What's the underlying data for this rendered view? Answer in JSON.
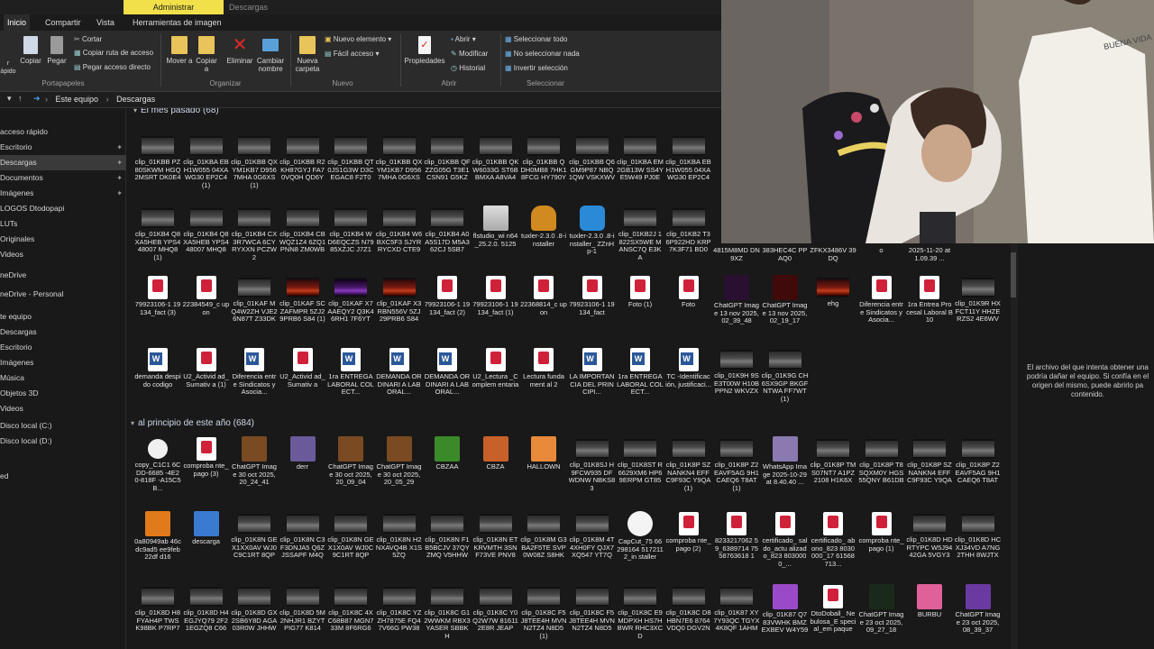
{
  "ribbon": {
    "context_tabs": {
      "admin": "Administrar",
      "downloads": "Descargas"
    },
    "tabs": [
      "Inicio",
      "Compartir",
      "Vista",
      "Herramientas de imagen"
    ],
    "clipboard": {
      "pin": "r\nápido",
      "copy": "Copiar",
      "paste": "Pegar",
      "cut": "Cortar",
      "copy_path": "Copiar ruta de acceso",
      "paste_shortcut": "Pegar acceso directo",
      "group": "Portapapeles"
    },
    "organize": {
      "move": "Mover a",
      "copy_to": "Copiar a",
      "delete": "Eliminar",
      "rename": "Cambiar nombre",
      "group": "Organizar"
    },
    "new": {
      "new_folder": "Nueva carpeta",
      "new_item": "Nuevo elemento",
      "easy_access": "Fácil acceso",
      "group": "Nuevo"
    },
    "open": {
      "properties": "Propiedades",
      "open": "Abrir",
      "edit": "Modificar",
      "history": "Historial",
      "group": "Abrir"
    },
    "select": {
      "select_all": "Seleccionar todo",
      "select_none": "No seleccionar nada",
      "invert": "Invertir selección",
      "group": "Seleccionar"
    }
  },
  "address": {
    "crumbs": [
      "Este equipo",
      "Descargas"
    ]
  },
  "sidebar": [
    {
      "label": "acceso rápido",
      "pin": false
    },
    {
      "label": "Escritorio",
      "pin": true
    },
    {
      "label": "Descargas",
      "pin": true,
      "selected": true
    },
    {
      "label": "Documentos",
      "pin": true
    },
    {
      "label": "Imágenes",
      "pin": true
    },
    {
      "label": "LOGOS Dtodopapi",
      "pin": false
    },
    {
      "label": "LUTs",
      "pin": false
    },
    {
      "label": "Originales",
      "pin": false
    },
    {
      "label": "Videos",
      "pin": false
    },
    {
      "label": "neDrive",
      "pin": false
    },
    {
      "label": "neDrive - Personal",
      "pin": false
    },
    {
      "label": "te equipo",
      "pin": false
    },
    {
      "label": "Descargas",
      "pin": false
    },
    {
      "label": "Escritorio",
      "pin": false
    },
    {
      "label": "Imágenes",
      "pin": false
    },
    {
      "label": "Música",
      "pin": false
    },
    {
      "label": "Objetos 3D",
      "pin": false
    },
    {
      "label": "Videos",
      "pin": false
    },
    {
      "label": "Disco local (C:)",
      "pin": false
    },
    {
      "label": "Disco local (D:)",
      "pin": false
    },
    {
      "label": "ed",
      "pin": false
    }
  ],
  "groups": {
    "last_month": "El mes pasado (68)",
    "this_year": "al principio de este año (684)"
  },
  "files_row1": [
    {
      "name": "clip_01KBB PZ80SKWM HGQ2MSRT DK0E4",
      "kind": "vid"
    },
    {
      "name": "clip_01KBA EBH1W055 04XAWG30 EP2C4 (1)",
      "kind": "vid"
    },
    {
      "name": "clip_01KBB QXYM1KB7 D9567MHA 0G6XS (1)",
      "kind": "vid"
    },
    {
      "name": "clip_01KBB R2KH87GYJ FA70VQ0H QD6Y",
      "kind": "vid"
    },
    {
      "name": "clip_01KBB QT0JS1G3W D3CEGAC8 F2T0",
      "kind": "vid"
    },
    {
      "name": "clip_01KBB QXYM1KB7 D9567MHA 0G6XS",
      "kind": "vid"
    },
    {
      "name": "clip_01KBB QFZZG05G T3E1CSN91 G5KZ",
      "kind": "vid"
    },
    {
      "name": "clip_01KBB QKW6033G ST6BBMXA A8VA4",
      "kind": "vid"
    },
    {
      "name": "clip_01KBB QDH0MB8 7HK18FCG HY790Y",
      "kind": "vid"
    },
    {
      "name": "clip_01KBB Q6GM9P87 NBQ1QW VSKXWV",
      "kind": "vid"
    },
    {
      "name": "clip_01KBA EM2GB13W SS4YE5W49 PJ0E",
      "kind": "vid"
    },
    {
      "name": "clip_01KBA EBH1W055 04XAWG30 EP2C4",
      "kind": "vid"
    }
  ],
  "files_row2": [
    {
      "name": "clip_01KB4 Q8XA5HEB YPS448007 MHQ8 (1)",
      "kind": "vid"
    },
    {
      "name": "clip_01KB4 Q8XA5HEB YPS448007 MHQ8",
      "kind": "vid"
    },
    {
      "name": "clip_01KB4 CX3R7WCA 6CYRYXXN PCZW2",
      "kind": "vid"
    },
    {
      "name": "clip_01KB4 CBWQZ1Z4 6ZQ1PNN8 ZM0WB",
      "kind": "vid"
    },
    {
      "name": "clip_01KB4 WD6EQCZS N7985XZJC J7Z1",
      "kind": "vid"
    },
    {
      "name": "clip_01KB4 W6BXC5F3 SJYRRYCXD CTE9",
      "kind": "vid"
    },
    {
      "name": "clip_01KB4 A0A5S17D M5A362CJ 5SB7",
      "kind": "vid"
    },
    {
      "name": "flstudio_wi n64_25.2.0. 5125",
      "kind": "app"
    },
    {
      "name": "tuxler-2.3.0 .8-installer",
      "kind": "app2"
    },
    {
      "name": "tuxler-2.3.0 .8-installer_ ZZnHp-1",
      "kind": "app3"
    },
    {
      "name": "clip_01KB2J 1822SX5WE MANSC7Q E3KA",
      "kind": "vid"
    },
    {
      "name": "clip_01KB2 T36P922HD KRP7K3F71 BD0",
      "kind": "vid"
    }
  ],
  "files_row3": [
    {
      "name": "79923106-1 19134_fact (3)",
      "kind": "pdf"
    },
    {
      "name": "22384549_c upon",
      "kind": "pdf"
    },
    {
      "name": "clip_01KAF MQ4W2ZH VJE26N87T Z33DK",
      "kind": "vid"
    },
    {
      "name": "clip_01KAF SCZAFMPR 5ZJ29PRB6 S84 (1)",
      "kind": "vid3"
    },
    {
      "name": "clip_01KAF X7AAEQY2 Q3K46RH1 7F6YT",
      "kind": "vid4"
    },
    {
      "name": "clip_01KAF X3RBN556V 5ZJ29PRB6 S84",
      "kind": "vid3"
    },
    {
      "name": "79923106-1 19134_fact (2)",
      "kind": "pdf"
    },
    {
      "name": "79923106-1 19134_fact (1)",
      "kind": "pdf"
    },
    {
      "name": "22368814_c upon",
      "kind": "pdf"
    },
    {
      "name": "79923106-1 19134_fact",
      "kind": "pdf"
    },
    {
      "name": "Foto (1)",
      "kind": "pdf"
    },
    {
      "name": "Foto",
      "kind": "pdf"
    },
    {
      "name": "ChatGPT Image 13 nov 2025, 02_39_48",
      "kind": "img-dark"
    },
    {
      "name": "ChatGPT Image 13 nov 2025, 02_19_17",
      "kind": "img-red"
    },
    {
      "name": "ehg",
      "kind": "vid3"
    },
    {
      "name": "Diferencia entre Sindicatos y Asocia...",
      "kind": "pdf"
    },
    {
      "name": "1ra Entrea Procesal Laboral B10",
      "kind": "pdf"
    },
    {
      "name": "clip_01K9R HXFCT11Y HHZERZS2 4E6WV",
      "kind": "vid"
    }
  ],
  "files_row3_top": [
    "4815M8MD DN9XZ",
    "383HEC4C PPAQ0",
    "ZFKX3486V 39DQ",
    "o",
    "2025-11-20 at 1.09.39 ..."
  ],
  "files_row4": [
    {
      "name": "demanda despido codigo",
      "kind": "doc"
    },
    {
      "name": "U2_Activid ad_Sumativ a (1)",
      "kind": "pdf"
    },
    {
      "name": "Diferencia entre Sindicatos y Asocia...",
      "kind": "doc"
    },
    {
      "name": "U2_Activid ad_Sumativ a",
      "kind": "pdf"
    },
    {
      "name": "1ra ENTREGA LABORAL COLECT...",
      "kind": "doc"
    },
    {
      "name": "DEMANDA ORDINARI A LABORAL...",
      "kind": "doc"
    },
    {
      "name": "DEMANDA ORDINARI A LABORAL...",
      "kind": "doc"
    },
    {
      "name": "U2_Lectura _Complem entaria",
      "kind": "pdf"
    },
    {
      "name": "Lectura fundament al 2",
      "kind": "pdf"
    },
    {
      "name": "LA IMPORTAN CIA DEL PRINCIPI...",
      "kind": "doc"
    },
    {
      "name": "1ra ENTREGA LABORAL COLECT...",
      "kind": "doc"
    },
    {
      "name": "TC -Identificac ión, justificaci...",
      "kind": "doc"
    },
    {
      "name": "clip_01K9H 9SE3T00W H10BPPN2 WKVZX",
      "kind": "vid"
    },
    {
      "name": "clip_01K9G CH6SX9GP BKGFNTWA FF7WT (1)",
      "kind": "vid"
    }
  ],
  "files_row5": [
    {
      "name": "copy_C1C1 6CDD-6685 -4E20-818F -A15C5B...",
      "kind": "play"
    },
    {
      "name": "comproba nte_pago (3)",
      "kind": "pdf"
    },
    {
      "name": "ChatGPT Image 30 oct 2025, 20_24_41",
      "kind": "img-brown"
    },
    {
      "name": "derr",
      "kind": "img-purple"
    },
    {
      "name": "ChatGPT Image 30 oct 2025, 20_09_04",
      "kind": "img-brown"
    },
    {
      "name": "ChatGPT Image 30 oct 2025, 20_05_29",
      "kind": "img-brown"
    },
    {
      "name": "CBZAA",
      "kind": "img-green"
    },
    {
      "name": "CBZA",
      "kind": "img-orange"
    },
    {
      "name": "HALLOWN",
      "kind": "img-orange2"
    },
    {
      "name": "clip_01K8SJ H9FCW935 DFWDNW NBKS83",
      "kind": "vid"
    },
    {
      "name": "clip_01K8ST R6629XM6 HP69ERPM GT85",
      "kind": "vid"
    },
    {
      "name": "clip_01K8P SZNANKN4 EFFC9F93C Y9QA (1)",
      "kind": "vid"
    },
    {
      "name": "clip_01K8P Z2EAVF5AG 9H1CAEQ6 T8AT (1)",
      "kind": "vid"
    },
    {
      "name": "WhatsApp Image 2025-10-29 at 8.40.40 ...",
      "kind": "img-lav"
    },
    {
      "name": "clip_01K8P TMS07NT7 A1PZ2108 H1K6X",
      "kind": "vid"
    },
    {
      "name": "clip_01K8P T8SQXM0Y HGS55QNY B61DB",
      "kind": "vid"
    },
    {
      "name": "clip_01K8P SZNANKN4 EFFC9F93C Y9QA",
      "kind": "vid"
    },
    {
      "name": "clip_01K8P Z2EAVF5AG 9H1CAEQ6 T8AT",
      "kind": "vid"
    }
  ],
  "files_row6": [
    {
      "name": "0a80949ab 46cdc9ad5 ee9feb22df d16",
      "kind": "img-fire"
    },
    {
      "name": "descarga",
      "kind": "img-blue"
    },
    {
      "name": "clip_01K8N GEX1XX0AV WJ0C9C1RT 8QP",
      "kind": "vid"
    },
    {
      "name": "clip_01K8N C3F3DNJA5 Q6ZJSSAPF M4Q",
      "kind": "vid"
    },
    {
      "name": "clip_01K8N GEX1X0AV WJ0C9C1RT 8QP",
      "kind": "vid"
    },
    {
      "name": "clip_01K8N H2NXAVQ4B X1S5ZQ",
      "kind": "vid"
    },
    {
      "name": "clip_01K8N F1B5BCJV 37QYZMQ V5HHW",
      "kind": "vid"
    },
    {
      "name": "clip_01K8N ETKRVMTH 3SNF73VE PNV8",
      "kind": "vid"
    },
    {
      "name": "clip_01K8M G3BA2F5TE SVP0W08Z S8HK",
      "kind": "vid"
    },
    {
      "name": "clip_01K8M 4T4XH0FY QJX7XQ547 YT7Q",
      "kind": "vid"
    },
    {
      "name": "CapCut_75 66298164 5172112_in staller",
      "kind": "app-capcut"
    },
    {
      "name": "comproba nte_pago (2)",
      "kind": "pdf"
    },
    {
      "name": "8233217062 59_6389714 7558763618 1",
      "kind": "pdf"
    },
    {
      "name": "certificado_ saldo_actu alizado_823 8030000_...",
      "kind": "pdf"
    },
    {
      "name": "certificado_ abono_823 8030000_17 61568713...",
      "kind": "pdf"
    },
    {
      "name": "comproba nte_pago (1)",
      "kind": "pdf"
    },
    {
      "name": "clip_01K8D HDRTYPC W5J9442GA 5VGY3",
      "kind": "vid"
    },
    {
      "name": "clip_01K8D HCXJ34VD A7NG2THH 8WJTX",
      "kind": "vid"
    }
  ],
  "files_row7": [
    {
      "name": "clip_01K8D H8FYAH4P TWSK98BK P7RP7",
      "kind": "vid"
    },
    {
      "name": "clip_01K8D H4EGJYQ79 2F21EGZQ8 C66",
      "kind": "vid"
    },
    {
      "name": "clip_01K8D GX2SB6Y8D AGA03R0W JHHW",
      "kind": "vid"
    },
    {
      "name": "clip_01K8D 5M2NHJR1 BZYTPIG77 K814",
      "kind": "vid"
    },
    {
      "name": "clip_01K8C 4XC68B87 MGN733M 8F6RG6",
      "kind": "vid"
    },
    {
      "name": "clip_01K8C YZZH7875E FQ47V66G PW38",
      "kind": "vid"
    },
    {
      "name": "clip_01K8C G12WWKM RBX3YASER SBBKH",
      "kind": "vid"
    },
    {
      "name": "clip_01K8C Y0Q2W7W 816112E8R JEAP",
      "kind": "vid"
    },
    {
      "name": "clip_01K8C F5J8TEE4H MVNN2TZ4 N8D5 (1)",
      "kind": "vid"
    },
    {
      "name": "clip_01K8C F5J8TEE4H MVNN2TZ4 N8D5",
      "kind": "vid"
    },
    {
      "name": "clip_01K8C E9MDPXH HS7HBWR RHC3XCD",
      "kind": "vid"
    },
    {
      "name": "clip_01K8C D8HBN7E6 8764VDQ0 DGV2N",
      "kind": "vid"
    },
    {
      "name": "clip_01K87 XY7Y93QC TGYX4K8QF 1AHM",
      "kind": "vid"
    },
    {
      "name": "clip_01K87 Q783VWHK BMZEXBEV W4Y59",
      "kind": "img-purple2"
    },
    {
      "name": "DtoDoball_ Nebulosa_E special_em paque",
      "kind": "pdf"
    },
    {
      "name": "ChatGPT Image 23 oct 2025, 09_27_18",
      "kind": "img-dark2"
    },
    {
      "name": "BURBU",
      "kind": "img-candy"
    },
    {
      "name": "ChatGPT Image 23 oct 2025, 08_39_37",
      "kind": "img-purple3"
    }
  ],
  "preview": {
    "message": "El archivo del que intenta obtener una podría dañar el equipo. Si confía en el origen del mismo, puede abrirlo pa contenido."
  }
}
